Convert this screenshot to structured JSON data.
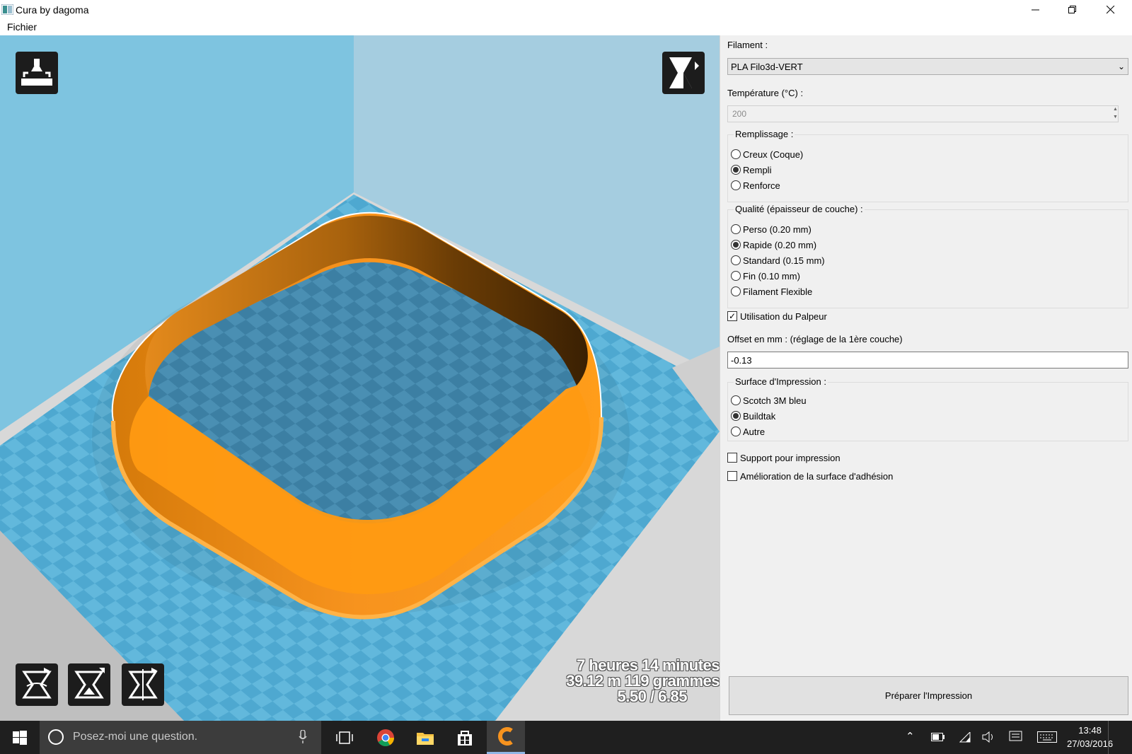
{
  "window": {
    "title": "Cura by dagoma",
    "menu": [
      "Fichier"
    ]
  },
  "viewport": {
    "print_time": "7 heures 14 minutes",
    "material_usage": "39.12 m 119 grammes",
    "ratio": "5.50 / 6.85",
    "tools": [
      "load-model",
      "view-mode",
      "rotate",
      "scale",
      "mirror"
    ]
  },
  "panel": {
    "filament_label": "Filament :",
    "filament_value": "PLA Filo3d-VERT",
    "temperature_label": "Température (°C) :",
    "temperature_value": "200",
    "fill_group": {
      "label": "Remplissage :",
      "options": [
        "Creux (Coque)",
        "Rempli",
        "Renforce"
      ],
      "selected": 1
    },
    "quality_group": {
      "label": "Qualité (épaisseur de couche) :",
      "options": [
        "Perso (0.20 mm)",
        "Rapide (0.20 mm)",
        "Standard (0.15 mm)",
        "Fin (0.10 mm)",
        "Filament Flexible"
      ],
      "selected": 1
    },
    "probe_label": "Utilisation du Palpeur",
    "probe_checked": true,
    "offset_label": "Offset en mm : (réglage de la 1ère couche)",
    "offset_value": "-0.13",
    "surface_group": {
      "label": "Surface d'Impression :",
      "options": [
        "Scotch 3M bleu",
        "Buildtak",
        "Autre"
      ],
      "selected": 1
    },
    "support_label": "Support pour impression",
    "support_checked": false,
    "adhesion_label": "Amélioration de la surface d'adhésion",
    "adhesion_checked": false,
    "prepare_button": "Préparer l'Impression"
  },
  "taskbar": {
    "search_placeholder": "Posez-moi une question.",
    "time": "13:48",
    "date": "27/03/2016",
    "apps": [
      "task-view",
      "chrome",
      "file-explorer",
      "store",
      "cura"
    ]
  },
  "colors": {
    "model_orange": "#f7931e",
    "bed_blue": "#5cb8e0",
    "sky_blue": "#7ec4e0",
    "taskbar": "#1f1f1f"
  }
}
